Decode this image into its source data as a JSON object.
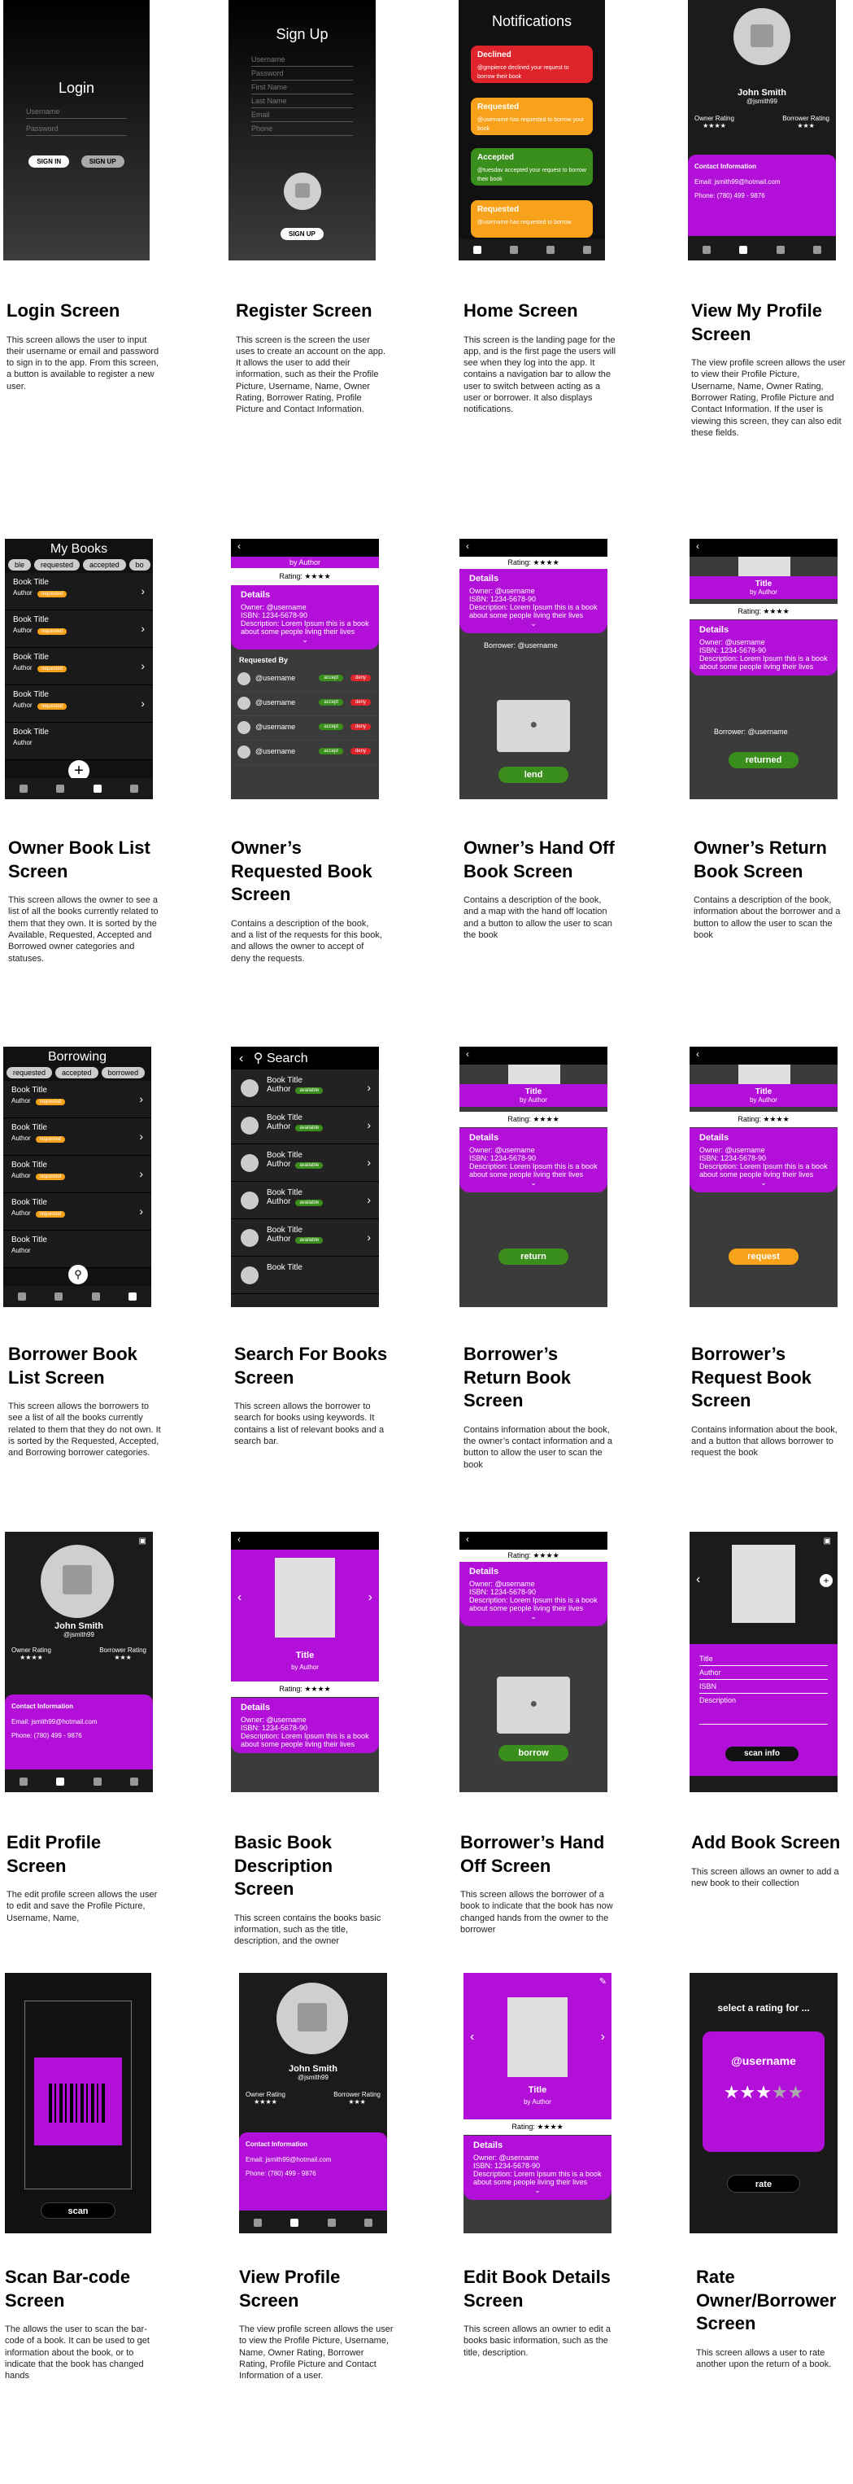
{
  "cards": [
    {
      "title": "Login Screen",
      "desc": "This screen allows the user to input their username or email and password to sign in to the app. From this screen, a button is available to register a new user."
    },
    {
      "title": "Register Screen",
      "desc": "This screen is the screen the user uses to create an account on the app. It allows the user to add their information, such as their the Profile Picture, Username, Name, Owner Rating, Borrower Rating, Profile Picture and Contact Information."
    },
    {
      "title": "Home Screen",
      "desc": "This screen is the landing page for the app, and is the first page the users will see when they log into the app. It contains a navigation bar to allow the user to switch between acting as a user or borrower. It also displays notifications."
    },
    {
      "title": "View My Profile Screen",
      "desc": "The view profile screen allows the user to view their Profile Picture, Username, Name, Owner Rating, Borrower Rating, Profile Picture and Contact Information. If the user is viewing this screen, they can also edit these fields."
    },
    {
      "title": "Owner Book List Screen",
      "desc": "This screen allows the owner to see a list of all the books currently related to them that they own. It is sorted by the Available, Requested, Accepted and Borrowed owner categories and statuses."
    },
    {
      "title": "Owner’s Requested Book Screen",
      "desc": "Contains a description of the book, and a list of the requests for this book, and allows the owner to accept of deny the requests."
    },
    {
      "title": "Owner’s Hand Off Book Screen",
      "desc": "Contains a description of the book, and a map with the hand off location and a button to allow the user to scan the book"
    },
    {
      "title": "Owner’s Return Book Screen",
      "desc": "Contains a description of the book, information about the borrower and a button to allow the user to scan the book"
    },
    {
      "title": "Borrower Book List Screen",
      "desc": "This screen allows the borrowers to see a list of all the books currently related to them that they do not own. It is sorted by the Requested, Accepted, and Borrowing borrower categories."
    },
    {
      "title": "Search For Books Screen",
      "desc": "This screen allows the borrower to search for books using keywords. It contains a list of relevant books and a search bar."
    },
    {
      "title": "Borrower’s Return Book Screen",
      "desc": "Contains information about the book, the owner’s contact information and a button to allow the user to scan the book"
    },
    {
      "title": "Borrower’s Request Book Screen",
      "desc": "Contains information about the book, and a button that allows borrower to request the book"
    },
    {
      "title": "Edit Profile Screen",
      "desc": "The edit profile screen allows the user to edit and save the Profile Picture, Username, Name,"
    },
    {
      "title": "Basic Book Description Screen",
      "desc": "This screen contains the books basic information, such as the title, description, and the owner"
    },
    {
      "title": "Borrower’s Hand Off Screen",
      "desc": "This screen allows the borrower of a book to indicate that the book has now changed hands from the owner to the borrower"
    },
    {
      "title": "Add Book Screen",
      "desc": "This screen allows an owner to add a new book to their collection"
    },
    {
      "title": "Scan Bar-code Screen",
      "desc": "The allows the user to scan the bar-code of a book. It can be used to get information about the book, or to indicate that the book has changed hands"
    },
    {
      "title": "View Profile Screen",
      "desc": "The view profile screen allows the user to view the Profile Picture, Username, Name, Owner Rating, Borrower Rating, Profile Picture and Contact Information of a user."
    },
    {
      "title": "Edit Book Details Screen",
      "desc": "This screen allows an owner to edit a books basic information, such as the title, description."
    },
    {
      "title": "Rate Owner/Borrower Screen",
      "desc": "This screen allows a user to rate another upon the return of a book."
    }
  ],
  "login": {
    "title": "Login",
    "username": "Username",
    "password": "Password",
    "signin": "SIGN IN",
    "signup": "SIGN UP"
  },
  "register": {
    "title": "Sign Up",
    "fields": [
      "Username",
      "Password",
      "First Name",
      "Last Name",
      "Email",
      "Phone"
    ],
    "signup": "SIGN UP"
  },
  "home": {
    "title": "Notifications",
    "items": [
      {
        "label": "Declined",
        "text": "@gmpierce declined your request to borrow their book"
      },
      {
        "label": "Requested",
        "text": "@username has requested to borrow your book"
      },
      {
        "label": "Accepted",
        "text": "@tuesdav accepted your request to borrow their book"
      },
      {
        "label": "Requested",
        "text": "@username has requested to borrow"
      }
    ]
  },
  "profile": {
    "name": "John Smith",
    "handle": "@jsmith99",
    "owner_rating_label": "Owner Rating",
    "owner_rating": "★★★★",
    "borrower_rating_label": "Borrower Rating",
    "borrower_rating": "★★★",
    "contact_title": "Contact Information",
    "email": "Email: jsmith99@hotmail.com",
    "phone": "Phone: (780) 499 - 9876"
  },
  "mybooks": {
    "title": "My Books",
    "tabs": [
      "ble",
      "requested",
      "accepted",
      "bo"
    ]
  },
  "booklist": {
    "book_title": "Book Title",
    "author": "Author",
    "status_req": "requested",
    "status_avail": "available"
  },
  "borrowing": {
    "title": "Borrowing",
    "tabs": [
      "requested",
      "accepted",
      "borrowed"
    ]
  },
  "search": {
    "back": "‹",
    "title": "Search"
  },
  "book": {
    "title": "Title",
    "by": "by Author",
    "rating": "Rating: ★★★★",
    "details": "Details",
    "owner": "Owner: @username",
    "isbn": "ISBN: 1234-5678-90",
    "desc": "Description: Lorem Ipsum this is a book about some people living their lives",
    "requested_by": "Requested By",
    "user": "@username",
    "accept": "accept",
    "deny": "deny",
    "borrower": "Borrower: @username",
    "lend": "lend",
    "returned": "returned",
    "return": "return",
    "request": "request",
    "borrow": "borrow"
  },
  "addbook": {
    "fields": [
      "Title",
      "Author",
      "ISBN",
      "Description"
    ],
    "scan_info": "scan info"
  },
  "scan": {
    "button": "scan"
  },
  "rate": {
    "title": "select a rating for ...",
    "user": "@username",
    "stars": "★★★",
    "stars_off": "★★",
    "button": "rate"
  }
}
